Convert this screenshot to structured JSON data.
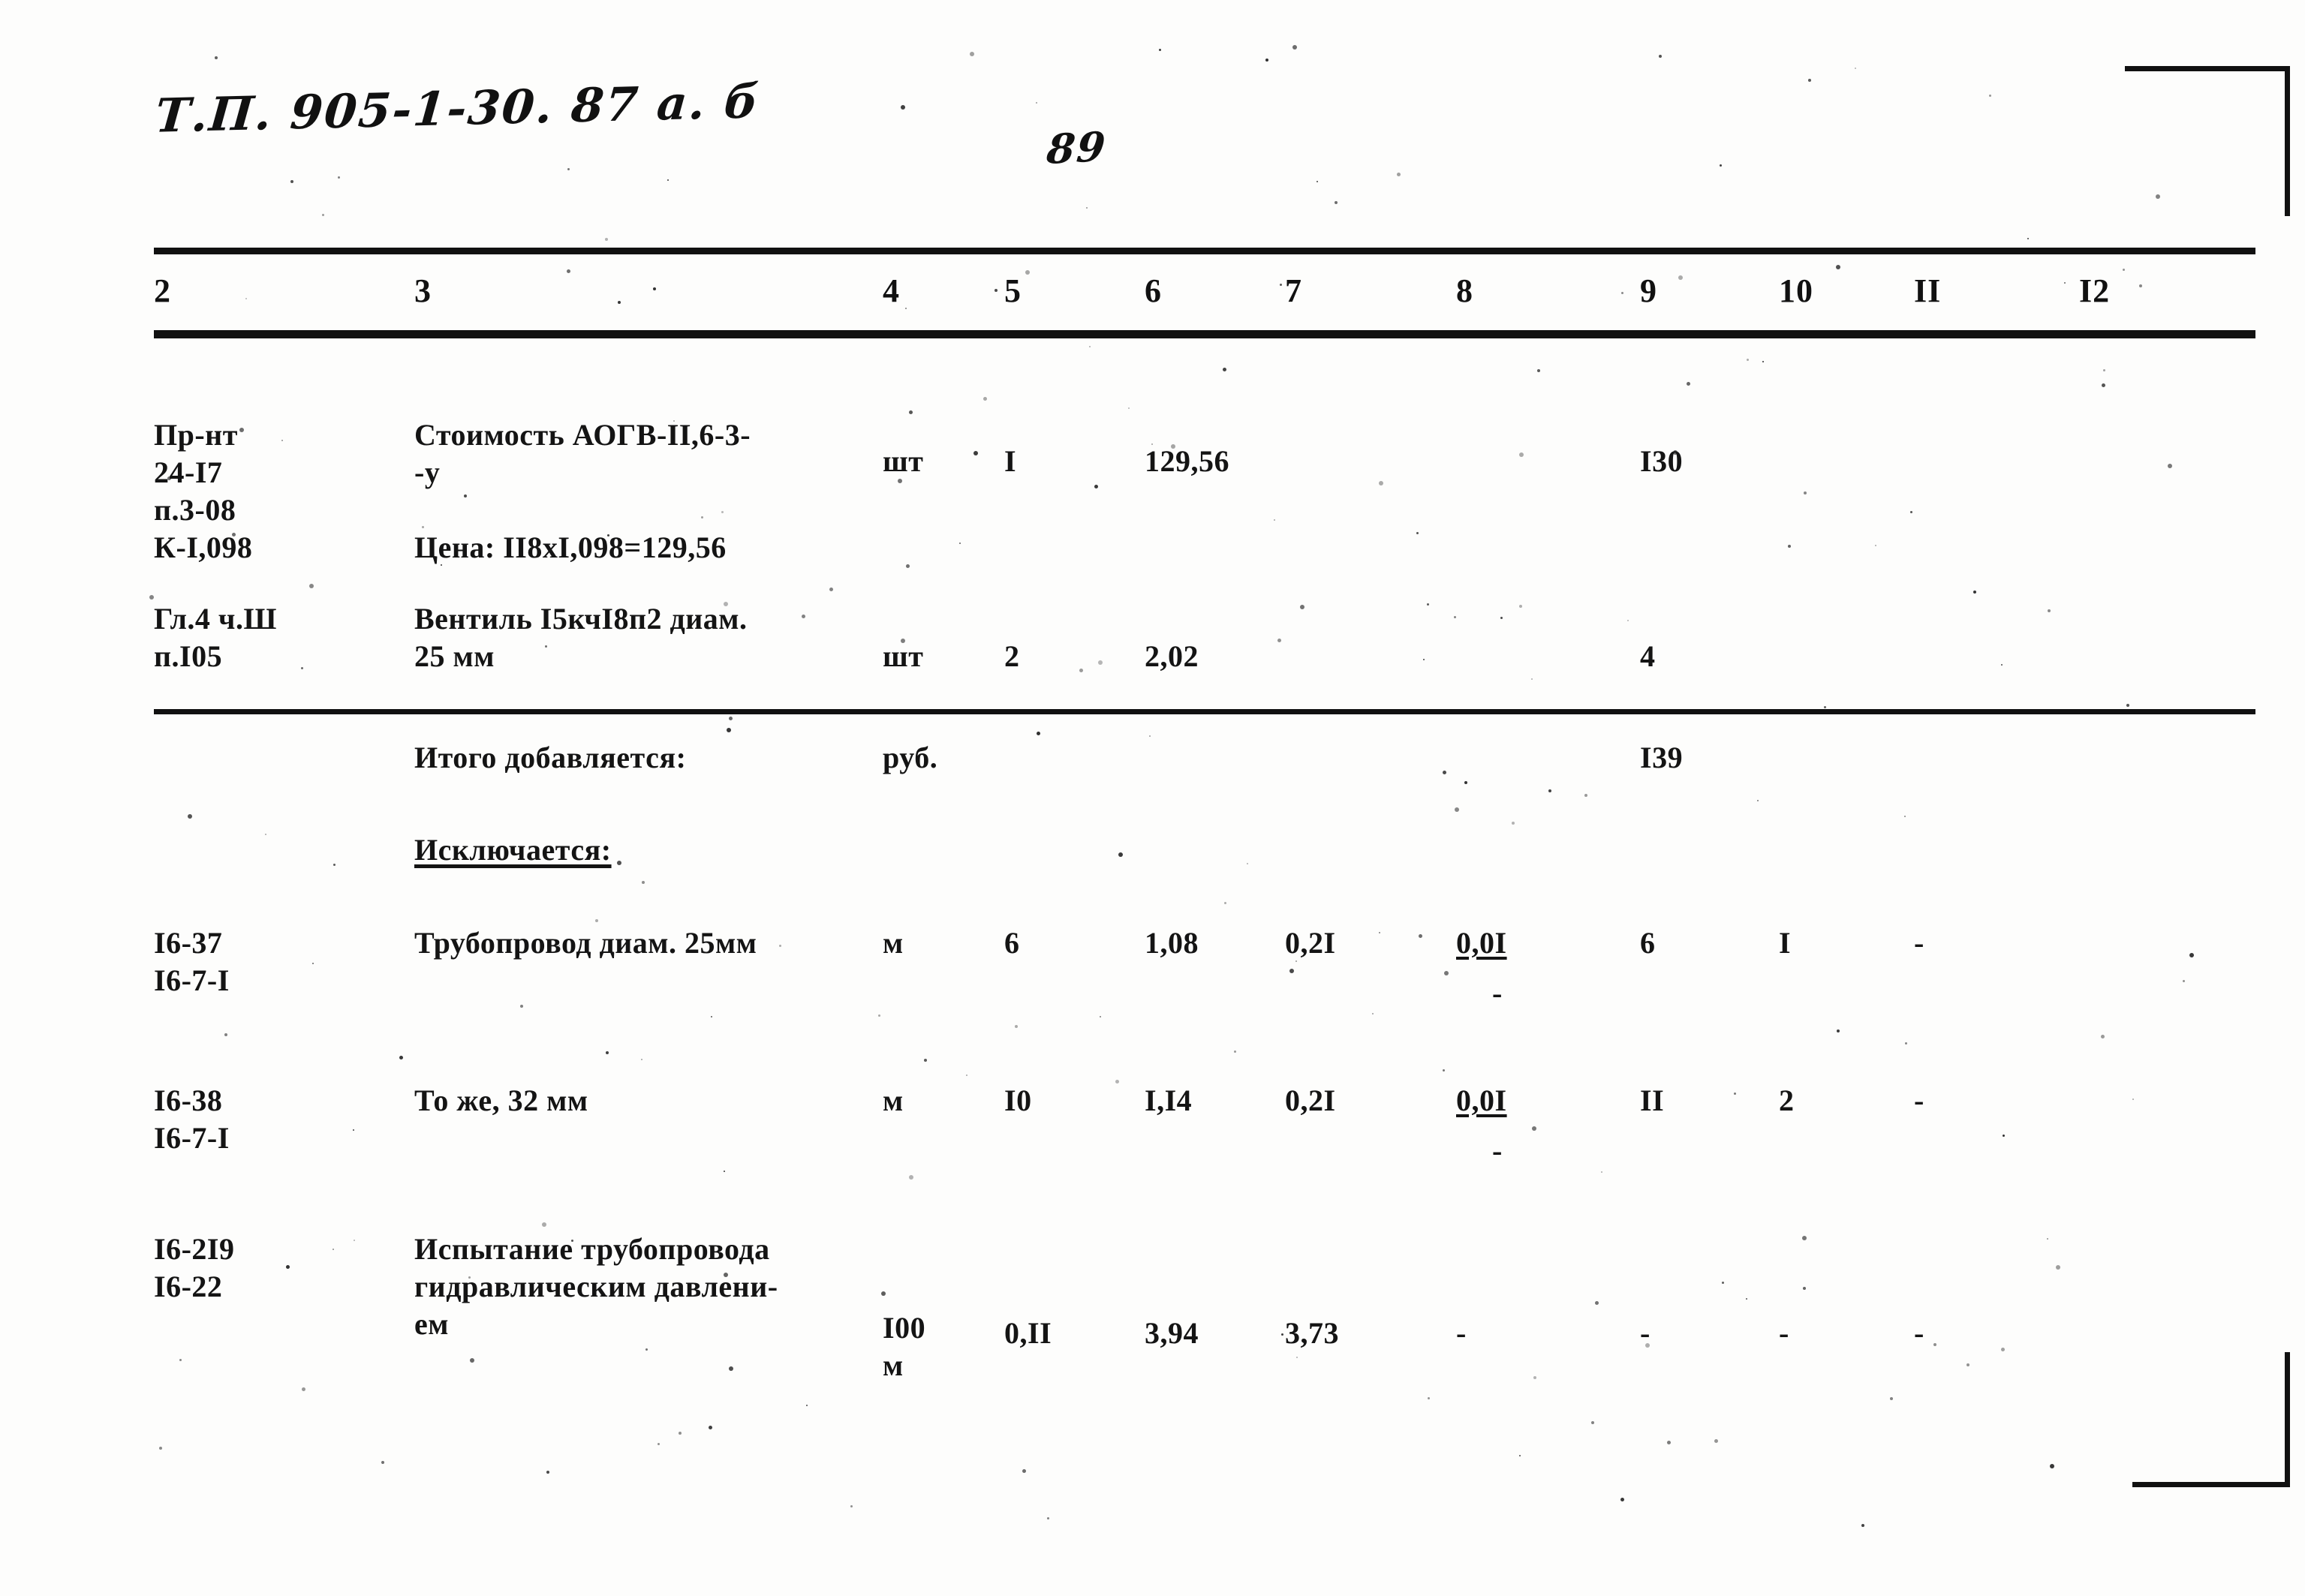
{
  "document": {
    "handwritten_code": "Т.П. 905-1-30. 87   а. б",
    "handwritten_page": "89"
  },
  "table": {
    "column_headers": [
      "2",
      "3",
      "4",
      "5",
      "6",
      "7",
      "8",
      "9",
      "10",
      "II",
      "I2"
    ],
    "rows": [
      {
        "id": "row-aogv",
        "col2": "Пр-нт\n24-I7\nп.3-08\nК-I,098",
        "col3": "Стоимость АОГВ-II,6-3-\n-у\n\nЦена: II8xI,098=129,56",
        "col4": "шт",
        "col5": "I",
        "col6": "129,56",
        "col7": "",
        "col8": "",
        "col9": "I30",
        "col10": "",
        "col11": "",
        "col12": ""
      },
      {
        "id": "row-ventil",
        "col2": "Гл.4 ч.Ш\nп.I05",
        "col3": "Вентиль I5кчI8п2 диам.\n25 мм",
        "col4": "шт",
        "col5": "2",
        "col6": "2,02",
        "col7": "",
        "col8": "",
        "col9": "4",
        "col10": "",
        "col11": "",
        "col12": ""
      },
      {
        "id": "row-itogo",
        "col2": "",
        "col3": "Итого добавляется:",
        "col4": "руб.",
        "col5": "",
        "col6": "",
        "col7": "",
        "col8": "",
        "col9": "I39",
        "col10": "",
        "col11": "",
        "col12": ""
      },
      {
        "id": "row-isklyuchaetsya",
        "col2": "",
        "col3": "Исключается:",
        "col4": "",
        "col5": "",
        "col6": "",
        "col7": "",
        "col8": "",
        "col9": "",
        "col10": "",
        "col11": "",
        "col12": ""
      },
      {
        "id": "row-pipe-25",
        "col2": "I6-37\nI6-7-I",
        "col3": "Трубопровод диам. 25мм",
        "col4": "м",
        "col5": "6",
        "col6": "1,08",
        "col7": "0,2I",
        "col8": "0,0I",
        "col8_sub": "-",
        "col9": "6",
        "col10": "I",
        "col11": "-",
        "col12": ""
      },
      {
        "id": "row-pipe-32",
        "col2": "I6-38\nI6-7-I",
        "col3": "То же, 32 мм",
        "col4": "м",
        "col5": "I0",
        "col6": "I,I4",
        "col7": "0,2I",
        "col8": "0,0I",
        "col8_sub": "-",
        "col9": "II",
        "col10": "2",
        "col11": "-",
        "col12": ""
      },
      {
        "id": "row-hydro-test",
        "col2": "I6-2I9\nI6-22",
        "col3": "Испытание трубопровода\nгидравлическим давлени-\nем",
        "col4": "I00\nм",
        "col5": "0,II",
        "col6": "3,94",
        "col7": "3,73",
        "col8": "-",
        "col9": "-",
        "col10": "-",
        "col11": "-",
        "col12": ""
      }
    ]
  }
}
